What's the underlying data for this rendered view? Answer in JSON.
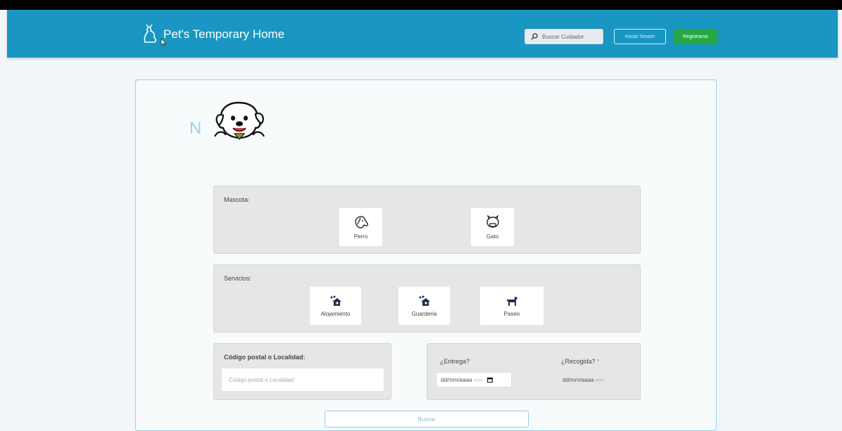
{
  "app": {
    "title": "Pet's Temporary Home"
  },
  "nav": {
    "search_button": "Buscar Cuidador",
    "login_button": "Iniciar Sesion",
    "register_button": "Registrarse"
  },
  "hero": {
    "letter": "N"
  },
  "pets": {
    "label": "Mascota:",
    "options": [
      {
        "label": "Perro",
        "icon": "dog-icon"
      },
      {
        "label": "Gato",
        "icon": "cat-icon"
      }
    ]
  },
  "services": {
    "label": "Servicios:",
    "options": [
      {
        "label": "Alojamiento",
        "icon": "house-paw-icon"
      },
      {
        "label": "Guarderia",
        "icon": "house-paw-icon"
      },
      {
        "label": "Paseo",
        "icon": "dog-walk-icon"
      }
    ]
  },
  "location": {
    "label": "Código postal o Localidad:",
    "placeholder": "Código postal o Localidad"
  },
  "dates": {
    "delivery_label": "¿Entrega?",
    "delivery_placeholder": "dd/mm/aaaa --:--",
    "pickup_label": "¿Recogida?",
    "pickup_marker": "*",
    "pickup_placeholder": "dd/mm/aaaa --:--"
  },
  "search": {
    "button": "Buscar"
  },
  "colors": {
    "navbar": "#1a96c2",
    "register": "#28a745",
    "panel": "#e6e6e6",
    "icon_dark": "#1f2f4d"
  }
}
